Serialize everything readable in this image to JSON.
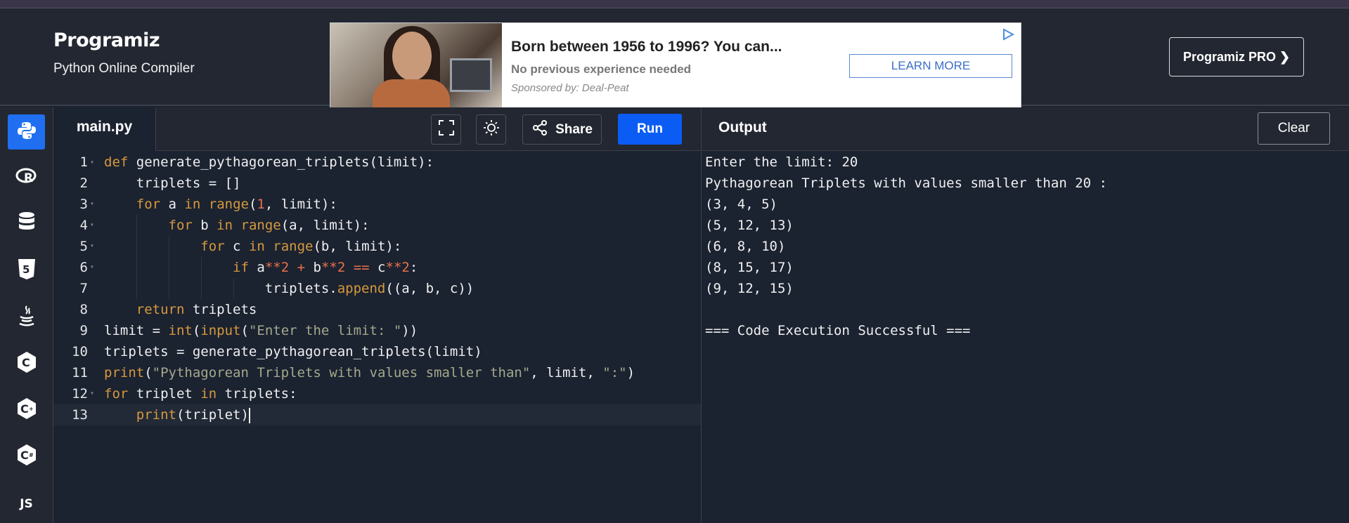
{
  "header": {
    "logo_text": "Programiz",
    "subtitle": "Python Online Compiler",
    "pro_button": "Programiz PRO ❯"
  },
  "ad": {
    "title": "Born between 1956 to 1996? You can...",
    "line2": "No previous experience needed",
    "line3": "Sponsored by: Deal-Peat",
    "button": "LEARN MORE"
  },
  "sidebar": {
    "items": [
      {
        "name": "python",
        "icon": "python-icon",
        "label": ""
      },
      {
        "name": "r",
        "icon": "r-icon",
        "label": "R"
      },
      {
        "name": "sql",
        "icon": "database-icon",
        "label": ""
      },
      {
        "name": "html",
        "icon": "html5-icon",
        "label": "5"
      },
      {
        "name": "java",
        "icon": "java-icon",
        "label": ""
      },
      {
        "name": "c",
        "icon": "c-icon",
        "label": "C"
      },
      {
        "name": "cpp",
        "icon": "cpp-icon",
        "label": "C"
      },
      {
        "name": "csharp",
        "icon": "csharp-icon",
        "label": "C"
      },
      {
        "name": "js",
        "icon": "js-icon",
        "label": "JS"
      }
    ]
  },
  "editor": {
    "tab": "main.py",
    "share_label": "Share",
    "run_label": "Run",
    "lines": [
      {
        "n": "1",
        "fold": true
      },
      {
        "n": "2",
        "fold": false
      },
      {
        "n": "3",
        "fold": true
      },
      {
        "n": "4",
        "fold": true
      },
      {
        "n": "5",
        "fold": true
      },
      {
        "n": "6",
        "fold": true
      },
      {
        "n": "7",
        "fold": false
      },
      {
        "n": "8",
        "fold": false
      },
      {
        "n": "9",
        "fold": false
      },
      {
        "n": "10",
        "fold": false
      },
      {
        "n": "11",
        "fold": false
      },
      {
        "n": "12",
        "fold": true
      },
      {
        "n": "13",
        "fold": false
      }
    ]
  },
  "output": {
    "title": "Output",
    "clear_label": "Clear",
    "lines": [
      "Enter the limit: 20",
      "Pythagorean Triplets with values smaller than 20 :",
      "(3, 4, 5)",
      "(5, 12, 13)",
      "(6, 8, 10)",
      "(8, 15, 17)",
      "(9, 12, 15)",
      "",
      "=== Code Execution Successful ==="
    ]
  },
  "colors": {
    "run_button": "#0b5cf5",
    "keyword": "#d6993e",
    "number": "#e8714a",
    "string": "#a4a98c",
    "background": "#1b2230"
  }
}
